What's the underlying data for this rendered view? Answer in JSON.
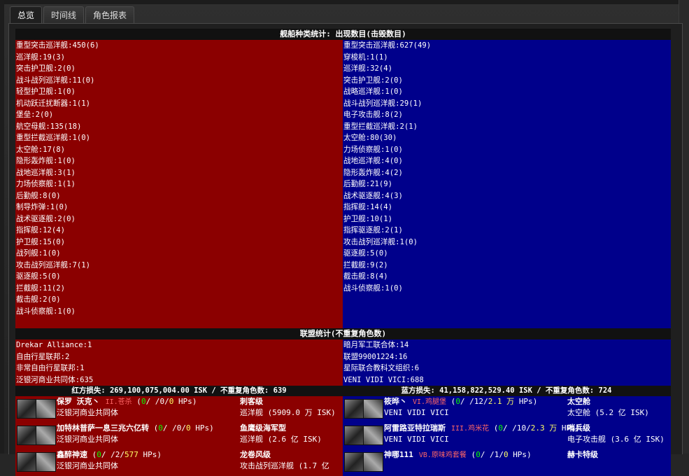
{
  "tabs": [
    "总览",
    "时间线",
    "角色报表"
  ],
  "ship_stats": {
    "title": "舰船种类统计: 出现数目(击毁数目)",
    "red": [
      "重型突击巡洋舰:450(6)",
      "巡洋舰:19(3)",
      "突击护卫舰:2(0)",
      "战斗战列巡洋舰:11(0)",
      "轻型护卫舰:1(0)",
      "机动跃迁扰断器:1(1)",
      "堡垒:2(0)",
      "航空母舰:135(18)",
      "重型拦截巡洋舰:1(0)",
      "太空舱:17(8)",
      "隐形轰炸舰:1(0)",
      "战地巡洋舰:3(1)",
      "力场侦察舰:1(1)",
      "后勤舰:8(0)",
      "制导炸弹:1(0)",
      "战术驱逐舰:2(0)",
      "指挥舰:12(4)",
      "护卫舰:15(0)",
      "战列舰:1(0)",
      "攻击战列巡洋舰:7(1)",
      "驱逐舰:5(0)",
      "拦截舰:11(2)",
      "截击舰:2(0)",
      "战斗侦察舰:1(0)"
    ],
    "blue": [
      "重型突击巡洋舰:627(49)",
      "穿梭机:1(1)",
      "巡洋舰:32(4)",
      "突击护卫舰:2(0)",
      "战略巡洋舰:1(0)",
      "战斗战列巡洋舰:29(1)",
      "电子攻击舰:8(2)",
      "重型拦截巡洋舰:2(1)",
      "太空舱:80(30)",
      "力场侦察舰:1(0)",
      "战地巡洋舰:4(0)",
      "隐形轰炸舰:4(2)",
      "后勤舰:21(9)",
      "战术驱逐舰:4(3)",
      "指挥舰:14(4)",
      "护卫舰:10(1)",
      "指挥驱逐舰:2(1)",
      "攻击战列巡洋舰:1(0)",
      "驱逐舰:5(0)",
      "拦截舰:9(2)",
      "截击舰:8(4)",
      "战斗侦察舰:1(0)"
    ]
  },
  "alliance_stats": {
    "title": "联盟统计(不重复角色数)",
    "red": [
      "Drekar Alliance:1",
      "自由行星联邦:2",
      "非常自由行星联邦:1",
      "泛银河商业共同体:635"
    ],
    "blue": [
      "暗月军工联合体:14",
      "联盟99001224:16",
      "星际联合教科文组织:6",
      "VENI VIDI VICI:688"
    ]
  },
  "loss": {
    "red": "红方损失: 269,100,075,004.00 ISK / 不重复角色数: 639",
    "blue": "蓝方损失: 41,158,822,529.40 ISK / 不重复角色数: 724"
  },
  "kills_red": [
    {
      "name": "保罗 沃克丶",
      "tag": "II.苍杀",
      "hp_a": "0",
      "hp_b": "0",
      "hp_c": "0",
      "hp_unit": "HPs",
      "corp": "泛银河商业共同体",
      "ship": "刺客级",
      "ship_val": "巡洋舰 (5909.0 万 ISK)"
    },
    {
      "name": "加特林普萨一息三兆六亿转",
      "tag": "",
      "hp_a": "0",
      "hp_b": "0",
      "hp_c": "0",
      "hp_unit": "HPs",
      "corp": "泛银河商业共同体",
      "ship": "鱼鹰级海军型",
      "ship_val": "巡洋舰 (2.6 亿 ISK)"
    },
    {
      "name": "鑫醉神速",
      "tag": "",
      "hp_a": "0",
      "hp_b": "2",
      "hp_c": "577",
      "hp_unit": "HPs",
      "corp": "泛银河商业共同体",
      "ship": "龙卷风级",
      "ship_val": "攻击战列巡洋舰 (1.7 亿"
    }
  ],
  "kills_blue": [
    {
      "name": "筱晔丶",
      "tag": "VI.鸡腿堡",
      "hp_a": "0",
      "hp_b": "12",
      "hp_c": "2.1 万",
      "hp_unit": "HPs",
      "corp": "VENI VIDI VICI",
      "ship": "太空舱",
      "ship_val": "太空舱 (5.2 亿 ISK)"
    },
    {
      "name": "阿雷路亚特拉瑞斯",
      "tag": "III.鸡米花",
      "hp_a": "0",
      "hp_b": "10",
      "hp_c": "2.3 万",
      "hp_unit": "HPs",
      "corp": "VENI VIDI VICI",
      "ship": "哨兵级",
      "ship_val": "电子攻击舰 (3.6 亿 ISK)"
    },
    {
      "name": "神哪111",
      "tag": "VB.原味鸡套餐",
      "hp_a": "0",
      "hp_b": "1",
      "hp_c": "0",
      "hp_unit": "HPs",
      "corp": "",
      "ship": "赫卡特级",
      "ship_val": ""
    }
  ]
}
